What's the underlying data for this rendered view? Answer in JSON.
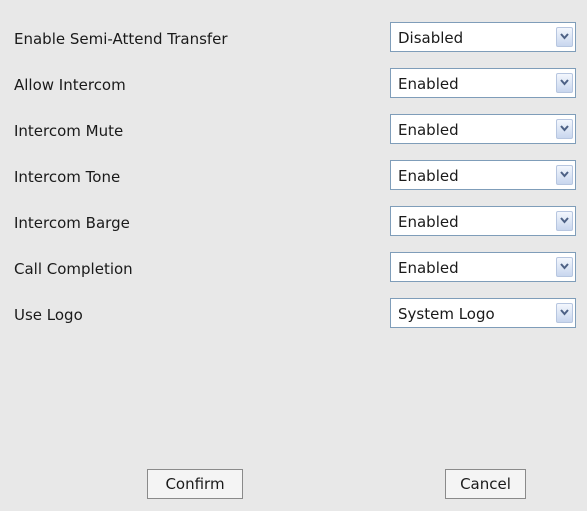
{
  "settings": [
    {
      "label": "Enable Semi-Attend Transfer",
      "value": "Disabled"
    },
    {
      "label": "Allow Intercom",
      "value": "Enabled"
    },
    {
      "label": "Intercom Mute",
      "value": "Enabled"
    },
    {
      "label": "Intercom Tone",
      "value": "Enabled"
    },
    {
      "label": "Intercom Barge",
      "value": "Enabled"
    },
    {
      "label": "Call Completion",
      "value": "Enabled"
    },
    {
      "label": "Use Logo",
      "value": "System Logo"
    }
  ],
  "buttons": {
    "confirm": "Confirm",
    "cancel": "Cancel"
  },
  "icons": {
    "dropdown": "chevron-down-icon"
  },
  "colors": {
    "panel_background": "#e8e8e8",
    "select_border": "#7f9db9",
    "arrow_color": "#4d6185"
  }
}
